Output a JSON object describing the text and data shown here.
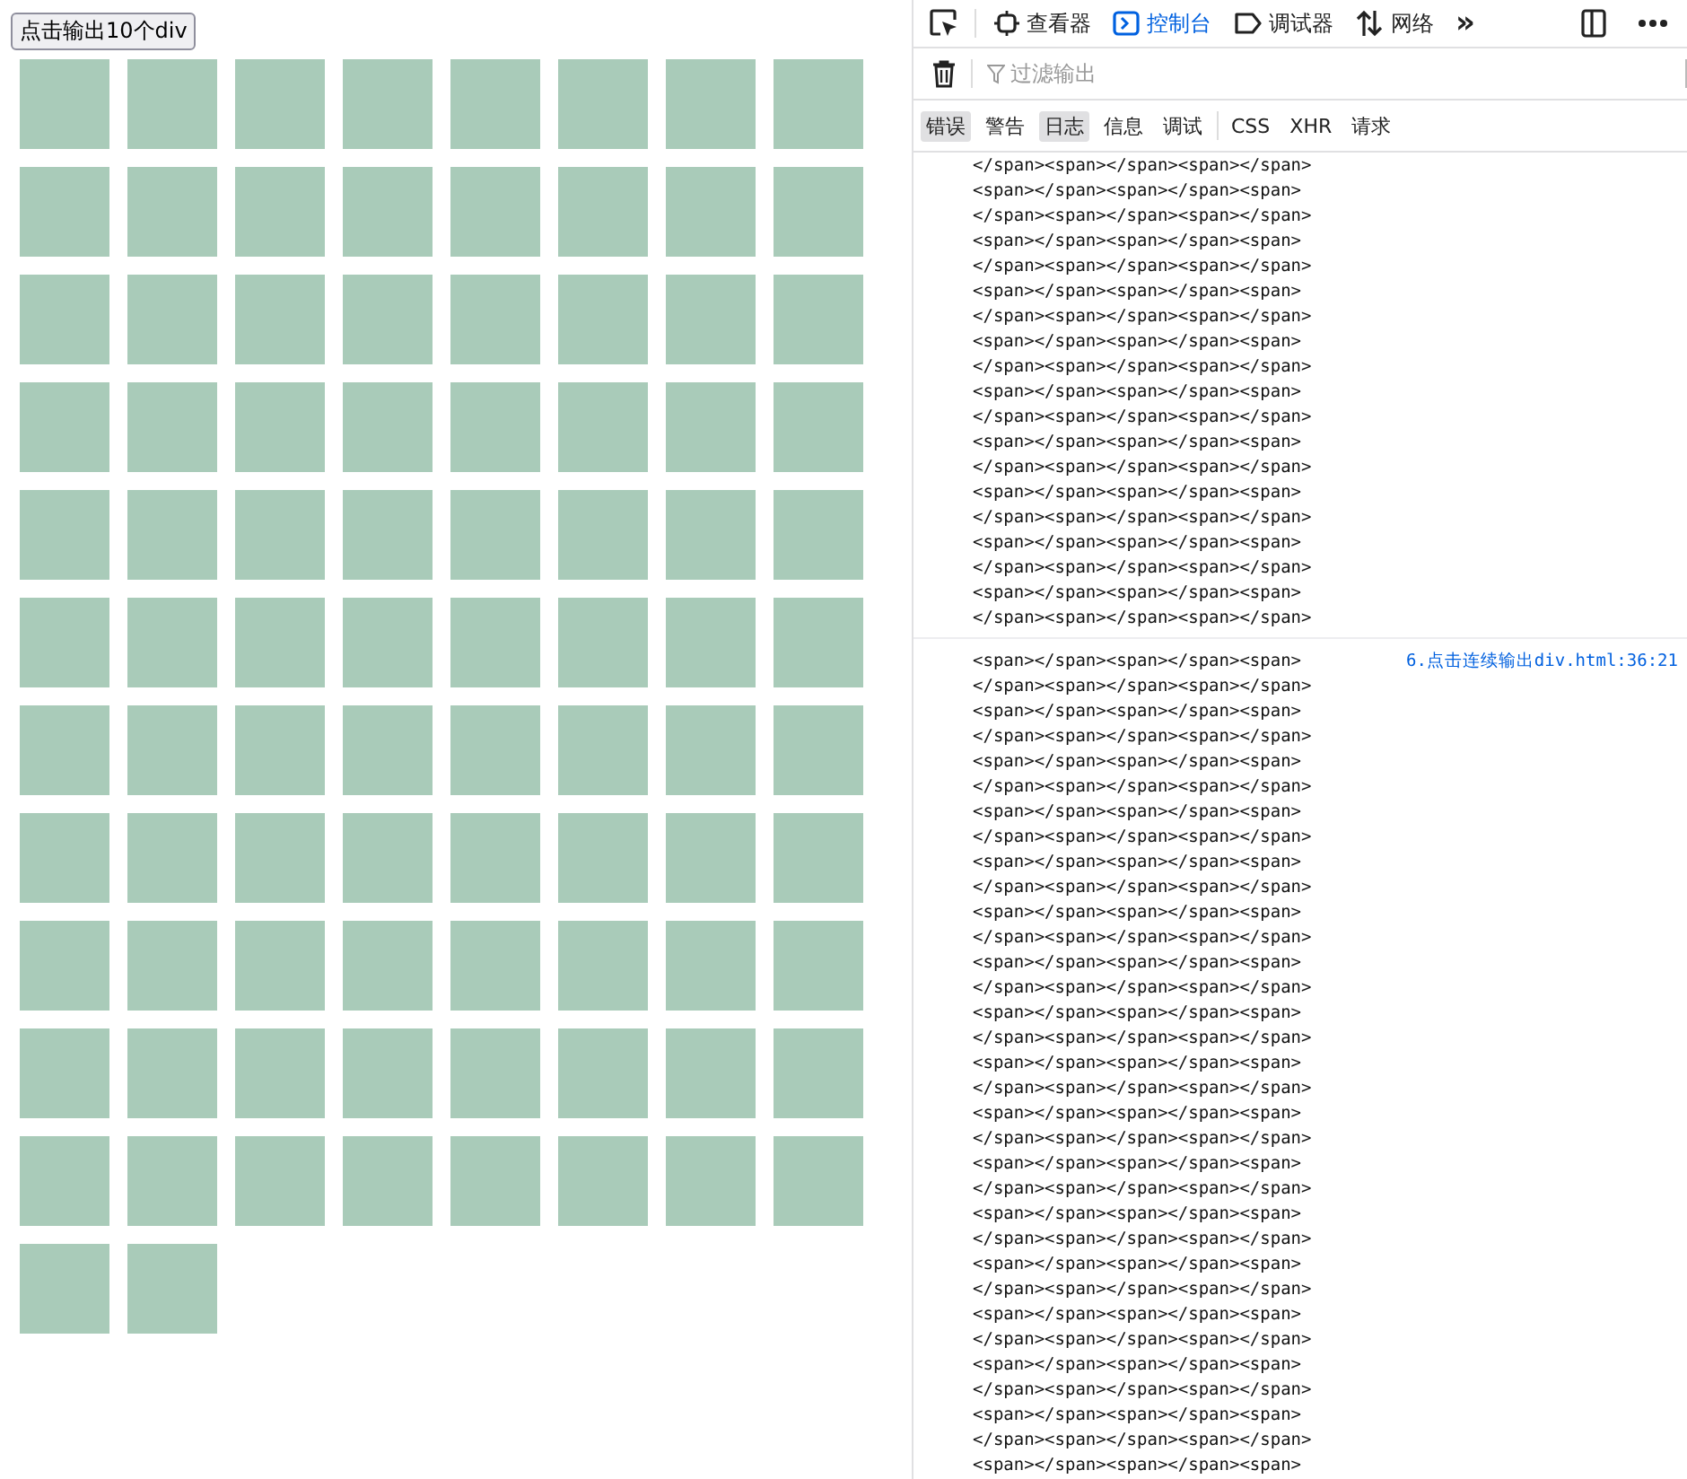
{
  "page": {
    "button": "点击输出10个div",
    "boxes": [
      {
        "kind": "div"
      },
      {
        "kind": "div"
      },
      {
        "kind": "div"
      },
      {
        "kind": "div"
      },
      {
        "kind": "div"
      },
      {
        "kind": "div"
      },
      {
        "kind": "div"
      },
      {
        "kind": "div"
      },
      {
        "kind": "div"
      },
      {
        "kind": "div"
      },
      {
        "kind": "div"
      },
      {
        "kind": "div"
      },
      {
        "kind": "div"
      },
      {
        "kind": "div"
      },
      {
        "kind": "div"
      },
      {
        "kind": "div"
      },
      {
        "kind": "div"
      },
      {
        "kind": "div"
      },
      {
        "kind": "div"
      },
      {
        "kind": "div"
      },
      {
        "kind": "div"
      },
      {
        "kind": "div"
      },
      {
        "kind": "div"
      },
      {
        "kind": "div"
      },
      {
        "kind": "div"
      },
      {
        "kind": "div"
      },
      {
        "kind": "div"
      },
      {
        "kind": "div"
      },
      {
        "kind": "div"
      },
      {
        "kind": "div"
      },
      {
        "kind": "div"
      },
      {
        "kind": "div"
      },
      {
        "kind": "div"
      },
      {
        "kind": "div"
      },
      {
        "kind": "div"
      },
      {
        "kind": "div"
      },
      {
        "kind": "div"
      },
      {
        "kind": "div"
      },
      {
        "kind": "div"
      },
      {
        "kind": "div"
      },
      {
        "kind": "div"
      },
      {
        "kind": "div"
      },
      {
        "kind": "div"
      },
      {
        "kind": "div"
      },
      {
        "kind": "div"
      },
      {
        "kind": "div"
      },
      {
        "kind": "div"
      },
      {
        "kind": "div"
      },
      {
        "kind": "div"
      },
      {
        "kind": "div"
      },
      {
        "kind": "div"
      },
      {
        "kind": "div"
      },
      {
        "kind": "div"
      },
      {
        "kind": "div"
      },
      {
        "kind": "div"
      },
      {
        "kind": "div"
      },
      {
        "kind": "div"
      },
      {
        "kind": "div"
      },
      {
        "kind": "div"
      },
      {
        "kind": "div"
      },
      {
        "kind": "div"
      },
      {
        "kind": "div"
      },
      {
        "kind": "div"
      },
      {
        "kind": "div"
      },
      {
        "kind": "div"
      },
      {
        "kind": "div"
      },
      {
        "kind": "div"
      },
      {
        "kind": "div"
      },
      {
        "kind": "div"
      },
      {
        "kind": "div"
      },
      {
        "kind": "div"
      },
      {
        "kind": "div"
      },
      {
        "kind": "div"
      },
      {
        "kind": "div"
      },
      {
        "kind": "div"
      },
      {
        "kind": "div"
      },
      {
        "kind": "div"
      },
      {
        "kind": "div"
      },
      {
        "kind": "div"
      },
      {
        "kind": "div"
      },
      {
        "kind": "div"
      },
      {
        "kind": "div"
      },
      {
        "kind": "div"
      },
      {
        "kind": "div"
      },
      {
        "kind": "div"
      },
      {
        "kind": "div"
      },
      {
        "kind": "div"
      },
      {
        "kind": "div"
      },
      {
        "kind": "div"
      },
      {
        "kind": "div"
      }
    ]
  },
  "devtools": {
    "tabs": [
      {
        "label": "查看器",
        "selected": false
      },
      {
        "label": "控制台",
        "selected": true
      },
      {
        "label": "调试器",
        "selected": false
      },
      {
        "label": "网络",
        "selected": false
      }
    ],
    "more_tabs": "»",
    "filter": {
      "placeholder": "过滤输出"
    },
    "levels": [
      {
        "label": "错误",
        "selected": true
      },
      {
        "label": "警告",
        "selected": false
      },
      {
        "label": "日志",
        "selected": true
      },
      {
        "label": "信息",
        "selected": false
      },
      {
        "label": "调试",
        "selected": false
      }
    ],
    "requests": [
      {
        "label": "CSS",
        "selected": false
      },
      {
        "label": "XHR",
        "selected": false
      },
      {
        "label": "请求",
        "selected": false
      }
    ],
    "messages": [
      {
        "lines": [
          "</span><span></span><span></span>",
          "<span></span><span></span><span>",
          "</span><span></span><span></span>",
          "<span></span><span></span><span>",
          "</span><span></span><span></span>",
          "<span></span><span></span><span>",
          "</span><span></span><span></span>",
          "<span></span><span></span><span>",
          "</span><span></span><span></span>",
          "<span></span><span></span><span>",
          "</span><span></span><span></span>",
          "<span></span><span></span><span>",
          "</span><span></span><span></span>",
          "<span></span><span></span><span>",
          "</span><span></span><span></span>",
          "<span></span><span></span><span>",
          "</span><span></span><span></span>",
          "<span></span><span></span><span>",
          "</span><span></span><span></span>"
        ]
      },
      {
        "source": "6.点击连续输出div.html:36:21",
        "lines": [
          "<span></span><span></span><span>",
          "</span><span></span><span></span>",
          "<span></span><span></span><span>",
          "</span><span></span><span></span>",
          "<span></span><span></span><span>",
          "</span><span></span><span></span>",
          "<span></span><span></span><span>",
          "</span><span></span><span></span>",
          "<span></span><span></span><span>",
          "</span><span></span><span></span>",
          "<span></span><span></span><span>",
          "</span><span></span><span></span>",
          "<span></span><span></span><span>",
          "</span><span></span><span></span>",
          "<span></span><span></span><span>",
          "</span><span></span><span></span>",
          "<span></span><span></span><span>",
          "</span><span></span><span></span>",
          "<span></span><span></span><span>",
          "</span><span></span><span></span>",
          "<span></span><span></span><span>",
          "</span><span></span><span></span>",
          "<span></span><span></span><span>",
          "</span><span></span><span></span>",
          "<span></span><span></span><span>",
          "</span><span></span><span></span>",
          "<span></span><span></span><span>",
          "</span><span></span><span></span>",
          "<span></span><span></span><span>",
          "</span><span></span><span></span>",
          "<span></span><span></span><span>",
          "</span><span></span><span></span>",
          "<span></span><span></span><span>"
        ]
      }
    ]
  }
}
